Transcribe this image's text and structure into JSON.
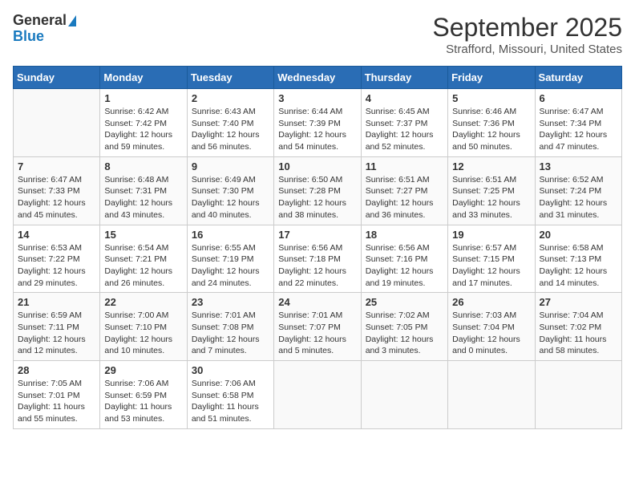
{
  "logo": {
    "line1": "General",
    "line2": "Blue"
  },
  "title": "September 2025",
  "location": "Strafford, Missouri, United States",
  "days_of_week": [
    "Sunday",
    "Monday",
    "Tuesday",
    "Wednesday",
    "Thursday",
    "Friday",
    "Saturday"
  ],
  "weeks": [
    [
      {
        "day": "",
        "sunrise": "",
        "sunset": "",
        "daylight": ""
      },
      {
        "day": "1",
        "sunrise": "Sunrise: 6:42 AM",
        "sunset": "Sunset: 7:42 PM",
        "daylight": "Daylight: 12 hours and 59 minutes."
      },
      {
        "day": "2",
        "sunrise": "Sunrise: 6:43 AM",
        "sunset": "Sunset: 7:40 PM",
        "daylight": "Daylight: 12 hours and 56 minutes."
      },
      {
        "day": "3",
        "sunrise": "Sunrise: 6:44 AM",
        "sunset": "Sunset: 7:39 PM",
        "daylight": "Daylight: 12 hours and 54 minutes."
      },
      {
        "day": "4",
        "sunrise": "Sunrise: 6:45 AM",
        "sunset": "Sunset: 7:37 PM",
        "daylight": "Daylight: 12 hours and 52 minutes."
      },
      {
        "day": "5",
        "sunrise": "Sunrise: 6:46 AM",
        "sunset": "Sunset: 7:36 PM",
        "daylight": "Daylight: 12 hours and 50 minutes."
      },
      {
        "day": "6",
        "sunrise": "Sunrise: 6:47 AM",
        "sunset": "Sunset: 7:34 PM",
        "daylight": "Daylight: 12 hours and 47 minutes."
      }
    ],
    [
      {
        "day": "7",
        "sunrise": "Sunrise: 6:47 AM",
        "sunset": "Sunset: 7:33 PM",
        "daylight": "Daylight: 12 hours and 45 minutes."
      },
      {
        "day": "8",
        "sunrise": "Sunrise: 6:48 AM",
        "sunset": "Sunset: 7:31 PM",
        "daylight": "Daylight: 12 hours and 43 minutes."
      },
      {
        "day": "9",
        "sunrise": "Sunrise: 6:49 AM",
        "sunset": "Sunset: 7:30 PM",
        "daylight": "Daylight: 12 hours and 40 minutes."
      },
      {
        "day": "10",
        "sunrise": "Sunrise: 6:50 AM",
        "sunset": "Sunset: 7:28 PM",
        "daylight": "Daylight: 12 hours and 38 minutes."
      },
      {
        "day": "11",
        "sunrise": "Sunrise: 6:51 AM",
        "sunset": "Sunset: 7:27 PM",
        "daylight": "Daylight: 12 hours and 36 minutes."
      },
      {
        "day": "12",
        "sunrise": "Sunrise: 6:51 AM",
        "sunset": "Sunset: 7:25 PM",
        "daylight": "Daylight: 12 hours and 33 minutes."
      },
      {
        "day": "13",
        "sunrise": "Sunrise: 6:52 AM",
        "sunset": "Sunset: 7:24 PM",
        "daylight": "Daylight: 12 hours and 31 minutes."
      }
    ],
    [
      {
        "day": "14",
        "sunrise": "Sunrise: 6:53 AM",
        "sunset": "Sunset: 7:22 PM",
        "daylight": "Daylight: 12 hours and 29 minutes."
      },
      {
        "day": "15",
        "sunrise": "Sunrise: 6:54 AM",
        "sunset": "Sunset: 7:21 PM",
        "daylight": "Daylight: 12 hours and 26 minutes."
      },
      {
        "day": "16",
        "sunrise": "Sunrise: 6:55 AM",
        "sunset": "Sunset: 7:19 PM",
        "daylight": "Daylight: 12 hours and 24 minutes."
      },
      {
        "day": "17",
        "sunrise": "Sunrise: 6:56 AM",
        "sunset": "Sunset: 7:18 PM",
        "daylight": "Daylight: 12 hours and 22 minutes."
      },
      {
        "day": "18",
        "sunrise": "Sunrise: 6:56 AM",
        "sunset": "Sunset: 7:16 PM",
        "daylight": "Daylight: 12 hours and 19 minutes."
      },
      {
        "day": "19",
        "sunrise": "Sunrise: 6:57 AM",
        "sunset": "Sunset: 7:15 PM",
        "daylight": "Daylight: 12 hours and 17 minutes."
      },
      {
        "day": "20",
        "sunrise": "Sunrise: 6:58 AM",
        "sunset": "Sunset: 7:13 PM",
        "daylight": "Daylight: 12 hours and 14 minutes."
      }
    ],
    [
      {
        "day": "21",
        "sunrise": "Sunrise: 6:59 AM",
        "sunset": "Sunset: 7:11 PM",
        "daylight": "Daylight: 12 hours and 12 minutes."
      },
      {
        "day": "22",
        "sunrise": "Sunrise: 7:00 AM",
        "sunset": "Sunset: 7:10 PM",
        "daylight": "Daylight: 12 hours and 10 minutes."
      },
      {
        "day": "23",
        "sunrise": "Sunrise: 7:01 AM",
        "sunset": "Sunset: 7:08 PM",
        "daylight": "Daylight: 12 hours and 7 minutes."
      },
      {
        "day": "24",
        "sunrise": "Sunrise: 7:01 AM",
        "sunset": "Sunset: 7:07 PM",
        "daylight": "Daylight: 12 hours and 5 minutes."
      },
      {
        "day": "25",
        "sunrise": "Sunrise: 7:02 AM",
        "sunset": "Sunset: 7:05 PM",
        "daylight": "Daylight: 12 hours and 3 minutes."
      },
      {
        "day": "26",
        "sunrise": "Sunrise: 7:03 AM",
        "sunset": "Sunset: 7:04 PM",
        "daylight": "Daylight: 12 hours and 0 minutes."
      },
      {
        "day": "27",
        "sunrise": "Sunrise: 7:04 AM",
        "sunset": "Sunset: 7:02 PM",
        "daylight": "Daylight: 11 hours and 58 minutes."
      }
    ],
    [
      {
        "day": "28",
        "sunrise": "Sunrise: 7:05 AM",
        "sunset": "Sunset: 7:01 PM",
        "daylight": "Daylight: 11 hours and 55 minutes."
      },
      {
        "day": "29",
        "sunrise": "Sunrise: 7:06 AM",
        "sunset": "Sunset: 6:59 PM",
        "daylight": "Daylight: 11 hours and 53 minutes."
      },
      {
        "day": "30",
        "sunrise": "Sunrise: 7:06 AM",
        "sunset": "Sunset: 6:58 PM",
        "daylight": "Daylight: 11 hours and 51 minutes."
      },
      {
        "day": "",
        "sunrise": "",
        "sunset": "",
        "daylight": ""
      },
      {
        "day": "",
        "sunrise": "",
        "sunset": "",
        "daylight": ""
      },
      {
        "day": "",
        "sunrise": "",
        "sunset": "",
        "daylight": ""
      },
      {
        "day": "",
        "sunrise": "",
        "sunset": "",
        "daylight": ""
      }
    ]
  ]
}
